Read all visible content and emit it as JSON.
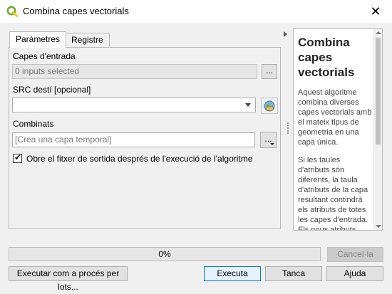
{
  "window": {
    "title": "Combina capes vectorials",
    "close_glyph": "✕"
  },
  "tabs": [
    {
      "label": "Paràmetres",
      "active": true
    },
    {
      "label": "Registre",
      "active": false
    }
  ],
  "params": {
    "input_layers": {
      "label": "Capes d'entrada",
      "value": "0 inputs selected",
      "button": "..."
    },
    "crs": {
      "label": "SRC destí [opcional]",
      "value": ""
    },
    "output": {
      "label": "Combinats",
      "placeholder": "[Crea una capa temporal]",
      "button": "..."
    },
    "open_output": {
      "label": "Obre el fitxer de sortida després de l'execució de l'algoritme",
      "checked": true
    }
  },
  "help": {
    "title": "Combina capes vectorials",
    "paragraphs": [
      "Aquest algoritme combina diverses capes vectorials amb el mateix tipus de geometria en una capa única.",
      "Si les taules d'atributs són diferents, la taula d'atributs de la capa resultant contindrà els atributs de totes les capes d'entrada. Els nous atributs definits s'afegiran"
    ]
  },
  "progress": {
    "text": "0%",
    "value": 0
  },
  "buttons": {
    "cancel": "Cancel·la",
    "batch": "Executar com a procés per lots...",
    "run": "Executa",
    "close": "Tanca",
    "help": "Ajuda"
  },
  "colors": {
    "accent_border": "#0078d7",
    "qgis_green": "#6cab31",
    "qgis_yellow": "#f2c811"
  }
}
